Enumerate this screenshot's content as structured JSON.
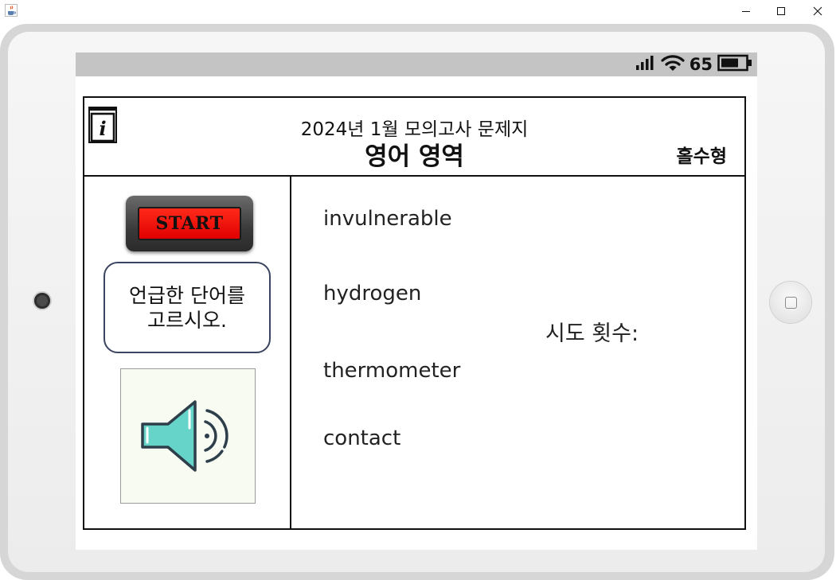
{
  "window": {
    "icon": "java-cup-icon",
    "controls": {
      "minimize": "–",
      "maximize": "☐",
      "close": "✕"
    }
  },
  "status_bar": {
    "icons": [
      "cellular-signal-icon",
      "wifi-icon",
      "battery-icon"
    ],
    "battery_percent": "65"
  },
  "exam": {
    "title_line1": "2024년 1월 모의고사 문제지",
    "title_line2": "영어 영역",
    "form_type": "홀수형",
    "info_icon_letter": "i"
  },
  "left_panel": {
    "start_label": "START",
    "instruction_line1": "언급한 단어를",
    "instruction_line2": "고르시오.",
    "speaker_icon": "speaker-sound-icon"
  },
  "choices": [
    "invulnerable",
    "hydrogen",
    "thermometer",
    "contact"
  ],
  "attempts_label": "시도 횟수:",
  "colors": {
    "start_red": "#ff1a10",
    "speaker_teal": "#66d4c8",
    "speaker_outline": "#2e3e4a",
    "status_bar_bg": "#c4c4c4",
    "tablet_frame": "#d6d6d6"
  }
}
